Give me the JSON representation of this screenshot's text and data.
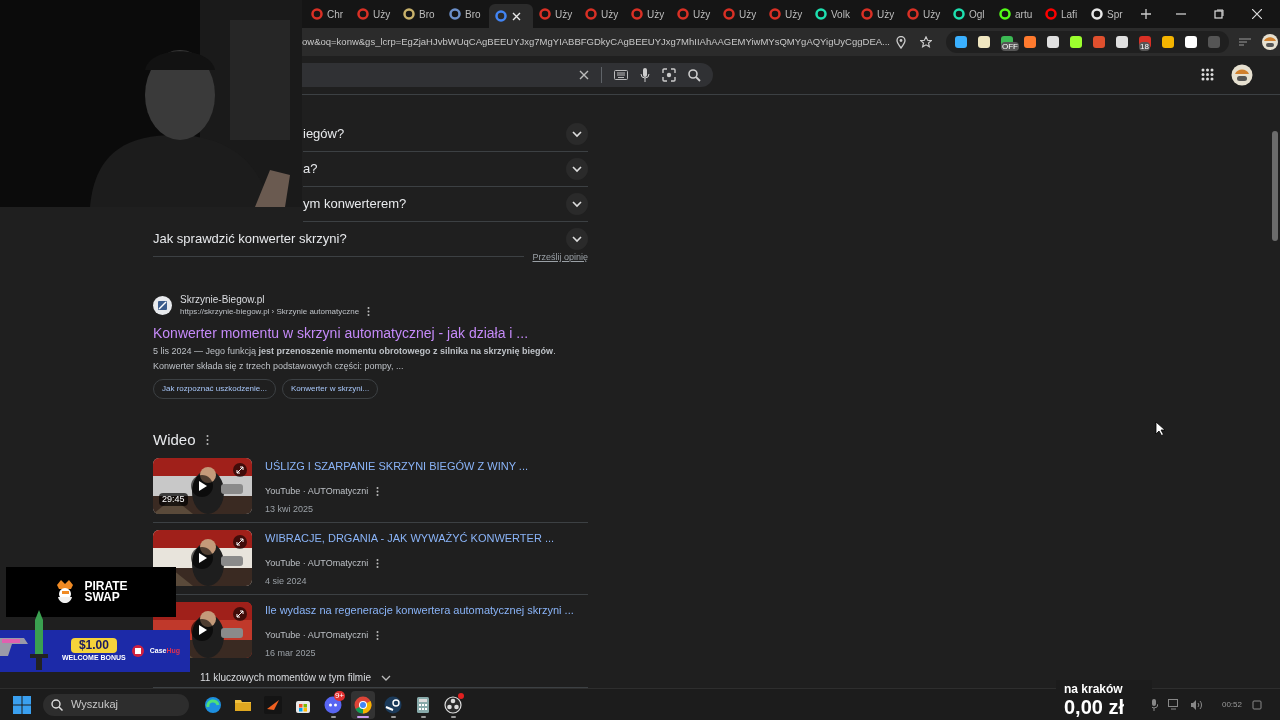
{
  "tabs": [
    {
      "label": "Chr",
      "color": "#d93025",
      "selected": false
    },
    {
      "label": "Uży",
      "color": "#d93025",
      "selected": false
    },
    {
      "label": "Bro",
      "color": "#c9b26b",
      "selected": false
    },
    {
      "label": "Bro",
      "color": "#6b8fc9",
      "selected": false
    },
    {
      "color": "#4285f4",
      "selected": true
    },
    {
      "label": "Uży",
      "color": "#d93025",
      "selected": false
    },
    {
      "label": "Uży",
      "color": "#d93025",
      "selected": false
    },
    {
      "label": "Uży",
      "color": "#d93025",
      "selected": false
    },
    {
      "label": "Uży",
      "color": "#d93025",
      "selected": false
    },
    {
      "label": "Uży",
      "color": "#d93025",
      "selected": false
    },
    {
      "label": "Uży",
      "color": "#d93025",
      "selected": false
    },
    {
      "label": "Volk",
      "color": "#1ee0b0",
      "selected": false
    },
    {
      "label": "Uży",
      "color": "#d93025",
      "selected": false
    },
    {
      "label": "Uży",
      "color": "#d93025",
      "selected": false
    },
    {
      "label": "Ogl",
      "color": "#1ee0b0",
      "selected": false
    },
    {
      "label": "artu",
      "color": "#53fc18",
      "selected": false
    },
    {
      "label": "Lafi",
      "color": "#ff0000",
      "selected": false
    },
    {
      "label": "Spr",
      "color": "#e8e8e8",
      "selected": false
    }
  ],
  "address_bar": {
    "url": "ow&oq=konw&gs_lcrp=EgZjaHJvbWUqCAgBEEUYJxg7MgYIABBFGDkyCAgBEEUYJxg7MhIIAhAAGEMYiwMYsQMYgAQYigUyCggDEA..."
  },
  "extensions": [
    {
      "color": "#3ab0ff"
    },
    {
      "color": "#f0e6c0"
    },
    {
      "color": "#3cba54",
      "badge": "OFF"
    },
    {
      "color": "#ff7a2e"
    },
    {
      "color": "#e0e0e0"
    },
    {
      "color": "#9cff2e"
    },
    {
      "color": "#e0502e"
    },
    {
      "color": "#e0e0e0"
    },
    {
      "color": "#d93025",
      "badge": "18"
    },
    {
      "color": "#f4b400"
    },
    {
      "color": "#ffffff"
    },
    {
      "color": "#555555"
    }
  ],
  "faq": [
    {
      "question": "iegów?",
      "expanded": false
    },
    {
      "question": "a?",
      "expanded": false
    },
    {
      "question": "ym konwerterem?",
      "expanded": false
    },
    {
      "question": "Jak sprawdzić konwerter skrzyni?",
      "expanded": false
    }
  ],
  "feedback_link": "Prześlij opinię",
  "result": {
    "site": "Skrzynie-Biegow.pl",
    "url": "https://skrzynie-biegow.pl › Skrzynie automatyczne",
    "title": "Konwerter momentu w skrzyni automatycznej - jak działa i ...",
    "visited": true,
    "snippet": "5 lis 2024 — Jego funkcją **jest przenoszenie momentu obrotowego z silnika na skrzynię biegów**. Konwerter składa się z trzech podstawowych części: pompy, ...",
    "chips": [
      "Jak rozpoznać uszkodzenie...",
      "Konwerter w skrzyni..."
    ]
  },
  "videos": {
    "heading": "Wideo",
    "items": [
      {
        "title": "UŚLIZG I SZARPANIE SKRZYNI BIEGÓW Z WINY ...",
        "source": "YouTube · AUTOmatyczni",
        "date": "13 kwi 2025",
        "duration": "29:45",
        "color": "#c8c8c8"
      },
      {
        "title": "WIBRACJE, DRGANIA - JAK WYWAŻYĆ KONWERTER ...",
        "source": "YouTube · AUTOmatyczni",
        "date": "4 sie 2024",
        "color": "#e8e4dc"
      },
      {
        "title": "Ile wydasz na regeneracje konwertera automatycznej skrzyni ...",
        "source": "YouTube · AUTOmatyczni",
        "date": "16 mar 2025",
        "color": "#c0392b"
      }
    ],
    "key_moments": "11 kluczowych momentów w tym filmie"
  },
  "pirate_swap": {
    "line1": "PIRATE",
    "line2": "SWAP"
  },
  "casehug": {
    "amount": "$1.00",
    "label": "WELCOME BONUS",
    "brand_1": "Case",
    "brand_2": "Hug"
  },
  "donation": {
    "label": "na kraków",
    "amount": "0,00 zł"
  },
  "taskbar": {
    "search_placeholder": "Wyszukaj",
    "apps": [
      {
        "kind": "edge",
        "running": false,
        "selected": false
      },
      {
        "kind": "folder",
        "running": false,
        "selected": false
      },
      {
        "kind": "arrow",
        "running": false,
        "selected": false
      },
      {
        "kind": "store",
        "running": false,
        "selected": false
      },
      {
        "kind": "chat",
        "running": true,
        "selected": false,
        "badge": "9+"
      },
      {
        "kind": "chrome",
        "running": true,
        "selected": true
      },
      {
        "kind": "steam",
        "running": true,
        "selected": false
      },
      {
        "kind": "calculator",
        "running": true,
        "selected": false
      },
      {
        "kind": "obs",
        "running": true,
        "selected": false
      }
    ]
  },
  "tray": {
    "time": "00:52"
  }
}
